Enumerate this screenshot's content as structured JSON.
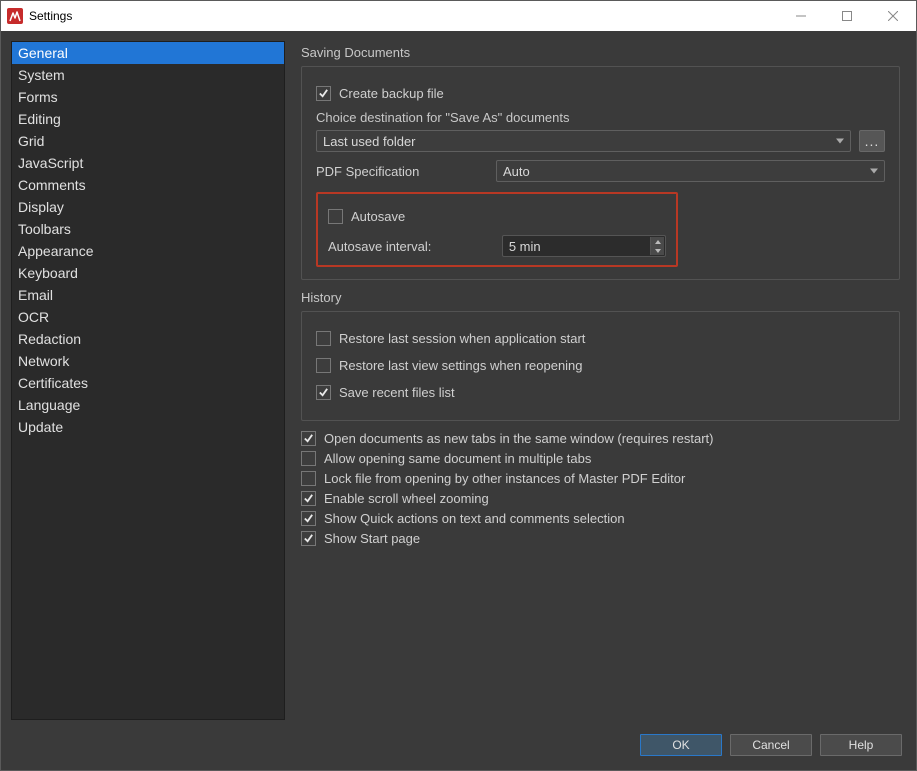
{
  "window": {
    "title": "Settings"
  },
  "sidebar": {
    "items": [
      "General",
      "System",
      "Forms",
      "Editing",
      "Grid",
      "JavaScript",
      "Comments",
      "Display",
      "Toolbars",
      "Appearance",
      "Keyboard",
      "Email",
      "OCR",
      "Redaction",
      "Network",
      "Certificates",
      "Language",
      "Update"
    ],
    "selected": "General"
  },
  "sections": {
    "saving": {
      "title": "Saving Documents",
      "create_backup": {
        "label": "Create backup file",
        "checked": true
      },
      "choice_destination_caption": "Choice destination for \"Save As\" documents",
      "destination_value": "Last used folder",
      "pdf_spec_label": "PDF Specification",
      "pdf_spec_value": "Auto",
      "autosave": {
        "label": "Autosave",
        "checked": false
      },
      "autosave_interval_label": "Autosave interval:",
      "autosave_interval_value": "5 min"
    },
    "history": {
      "title": "History",
      "restore_session": {
        "label": "Restore last session when application start",
        "checked": false
      },
      "restore_view": {
        "label": "Restore last view settings when reopening",
        "checked": false
      },
      "save_recent": {
        "label": "Save recent files list",
        "checked": true
      }
    },
    "options": [
      {
        "label": "Open documents as new tabs in the same window (requires restart)",
        "checked": true
      },
      {
        "label": "Allow opening same document in multiple tabs",
        "checked": false
      },
      {
        "label": "Lock file from opening by other instances of Master PDF Editor",
        "checked": false
      },
      {
        "label": "Enable scroll wheel zooming",
        "checked": true
      },
      {
        "label": "Show Quick actions on text and comments selection",
        "checked": true
      },
      {
        "label": "Show Start page",
        "checked": true
      }
    ]
  },
  "buttons": {
    "ok": "OK",
    "cancel": "Cancel",
    "help": "Help"
  }
}
